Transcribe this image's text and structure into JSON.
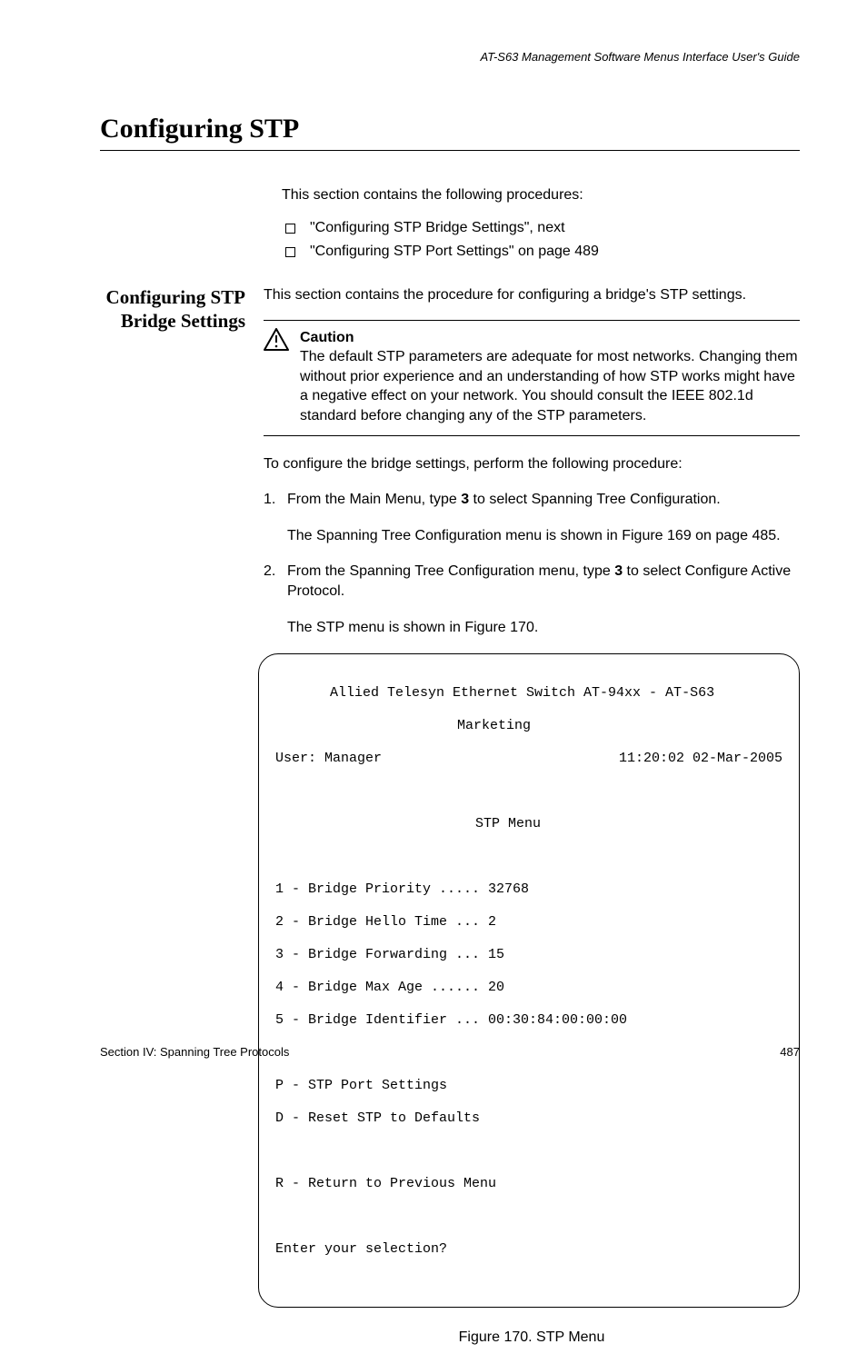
{
  "running_header": "AT-S63 Management Software Menus Interface User's Guide",
  "h1": "Configuring STP",
  "intro": "This section contains the following procedures:",
  "bullets": {
    "b0": "\"Configuring STP Bridge Settings\", next",
    "b1": "\"Configuring STP Port Settings\" on page 489"
  },
  "side_heading": "Configuring STP Bridge Settings",
  "side_body": "This section contains the procedure for configuring a bridge's STP settings.",
  "caution": {
    "title": "Caution",
    "body": "The default STP parameters are adequate for most networks. Changing them without prior experience and an understanding of how STP works might have a negative effect on your network. You should consult the IEEE 802.1d standard before changing any of the STP parameters."
  },
  "proc_intro": "To configure the bridge settings, perform the following procedure:",
  "steps": {
    "s1_num": "1.",
    "s1a": "From the Main Menu, type ",
    "s1b": "3",
    "s1c": " to select Spanning Tree Configuration.",
    "s1_sub": "The Spanning Tree Configuration menu is shown in Figure 169 on page 485.",
    "s2_num": "2.",
    "s2a": "From the Spanning Tree Configuration menu, type ",
    "s2b": "3",
    "s2c": " to select Configure Active Protocol.",
    "s2_sub": "The STP menu is shown in Figure 170."
  },
  "terminal": {
    "title1": "Allied Telesyn Ethernet Switch AT-94xx - AT-S63",
    "title2": "Marketing",
    "user": "User: Manager",
    "datetime": "11:20:02 02-Mar-2005",
    "menu_name": "STP Menu",
    "m1": "1 - Bridge Priority ..... 32768",
    "m2": "2 - Bridge Hello Time ... 2",
    "m3": "3 - Bridge Forwarding ... 15",
    "m4": "4 - Bridge Max Age ...... 20",
    "m5": "5 - Bridge Identifier ... 00:30:84:00:00:00",
    "mp": "P - STP Port Settings",
    "md": "D - Reset STP to Defaults",
    "mr": "R - Return to Previous Menu",
    "prompt": "Enter your selection?"
  },
  "fig_caption": "Figure 170. STP Menu",
  "footer_left": "Section IV: Spanning Tree Protocols",
  "footer_right": "487"
}
